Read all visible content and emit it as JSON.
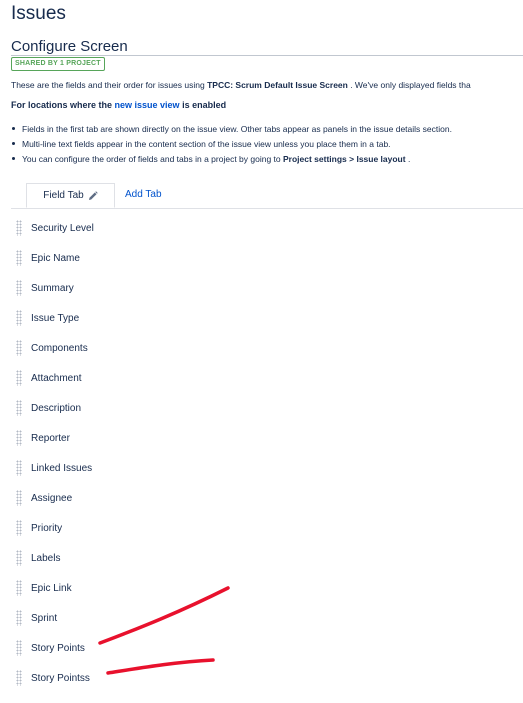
{
  "page": {
    "title": "Issues"
  },
  "config": {
    "title": "Configure Screen",
    "badge": "SHARED BY 1 PROJECT",
    "desc_prefix": "These are the fields and their order for issues using ",
    "screen_name": "TPCC: Scrum Default Issue Screen",
    "desc_suffix": " . We've only displayed fields tha",
    "loc_heading_prefix": "For locations where the ",
    "loc_heading_link": "new issue view",
    "loc_heading_suffix": " is enabled",
    "bullets": [
      "Fields in the first tab are shown directly on the issue view. Other tabs appear as panels in the issue details section.",
      "Multi-line text fields appear in the content section of the issue view unless you place them in a tab."
    ],
    "bullet3_prefix": "You can configure the order of fields and tabs in a project by going to ",
    "bullet3_bold": "Project settings > Issue layout",
    "bullet3_suffix": " ."
  },
  "tabs": {
    "active": "Field Tab",
    "add": "Add Tab"
  },
  "fields": [
    "Security Level",
    "Epic Name",
    "Summary",
    "Issue Type",
    "Components",
    "Attachment",
    "Description",
    "Reporter",
    "Linked Issues",
    "Assignee",
    "Priority",
    "Labels",
    "Epic Link",
    "Sprint",
    "Story Points",
    "Story Pointss"
  ],
  "colors": {
    "annotation": "#e8112d",
    "link": "#0052cc",
    "badge": "#57a55a"
  }
}
